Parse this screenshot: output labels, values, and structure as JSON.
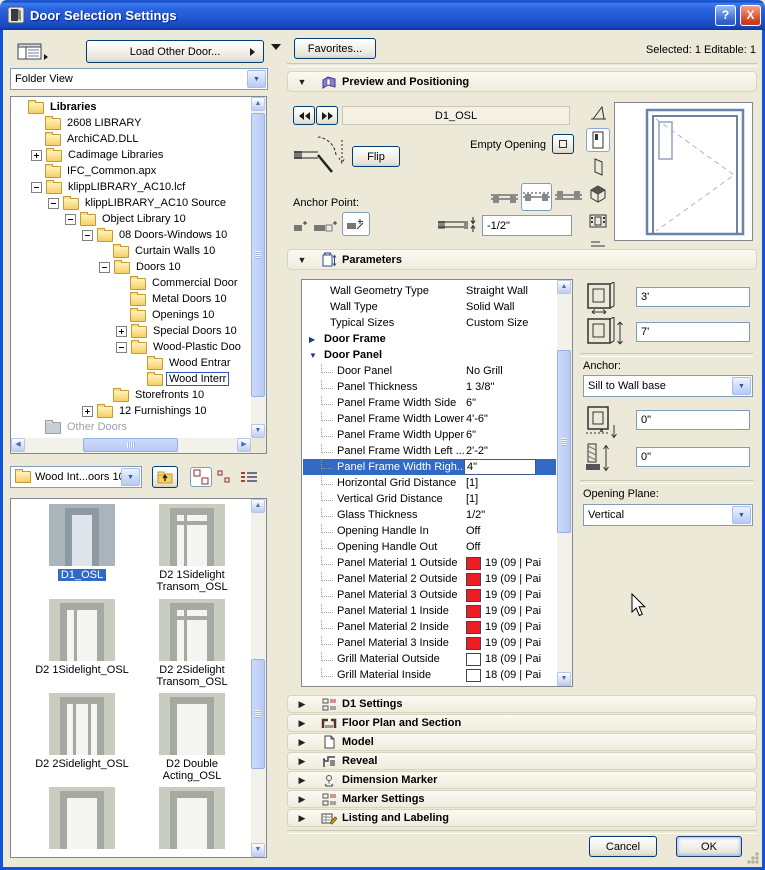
{
  "colors": {
    "selection": "#316ac5",
    "titlebar": "#1f55d2",
    "swatch_red": "#ee1c25",
    "swatch_white": "#ffffff"
  },
  "titlebar": {
    "title": "Door Selection Settings",
    "help": "?",
    "close": "X"
  },
  "left": {
    "load_button": "Load Other Door...",
    "view_select": "Folder View",
    "tree": [
      {
        "label": "Libraries"
      },
      {
        "label": "2608 LIBRARY"
      },
      {
        "label": "ArchiCAD.DLL"
      },
      {
        "label": "Cadimage Libraries"
      },
      {
        "label": "IFC_Common.apx"
      },
      {
        "label": "klippLIBRARY_AC10.lcf"
      },
      {
        "label": "klippLIBRARY_AC10 Source"
      },
      {
        "label": "Object Library 10"
      },
      {
        "label": "08 Doors-Windows 10"
      },
      {
        "label": "Curtain Walls 10"
      },
      {
        "label": "Doors 10"
      },
      {
        "label": "Commercial Door"
      },
      {
        "label": "Metal Doors 10"
      },
      {
        "label": "Openings 10"
      },
      {
        "label": "Special Doors 10"
      },
      {
        "label": "Wood-Plastic Doo"
      },
      {
        "label": "Wood Entrar"
      },
      {
        "label": "Wood Interr",
        "selected": true
      },
      {
        "label": "Storefronts 10"
      },
      {
        "label": "12 Furnishings 10"
      },
      {
        "label": "Other Doors",
        "disabled": true
      }
    ],
    "folder_select": "Wood Int...oors 10",
    "thumbnails": [
      {
        "label": "D1_OSL",
        "selected": true
      },
      {
        "label": "D2 1Sidelight Transom_OSL"
      },
      {
        "label": "D2 1Sidelight_OSL"
      },
      {
        "label": "D2 2Sidelight Transom_OSL"
      },
      {
        "label": "D2 2Sidelight_OSL"
      },
      {
        "label": "D2 Double Acting_OSL"
      },
      {
        "label": ""
      },
      {
        "label": ""
      }
    ]
  },
  "right": {
    "favorites_button": "Favorites...",
    "status": "Selected: 1 Editable: 1",
    "preview": {
      "title": "Preview and Positioning",
      "object_name": "D1_OSL",
      "flip_button": "Flip",
      "empty_opening_label": "Empty Opening",
      "anchor_point_label": "Anchor Point:",
      "reveal_value": "-1/2\""
    },
    "parameters": {
      "title": "Parameters",
      "rows": [
        {
          "label": "Wall Geometry Type",
          "value": "Straight Wall"
        },
        {
          "label": "Wall Type",
          "value": "Solid Wall"
        },
        {
          "label": "Typical Sizes",
          "value": "Custom Size"
        },
        {
          "label": "Door Frame",
          "value": ""
        },
        {
          "label": "Door Panel",
          "value": ""
        },
        {
          "label": "Door Panel",
          "value": "No Grill"
        },
        {
          "label": "Panel Thickness",
          "value": "1 3/8\""
        },
        {
          "label": "Panel Frame Width Side",
          "value": "6\""
        },
        {
          "label": "Panel Frame Width Lower",
          "value": "4'-6\""
        },
        {
          "label": "Panel Frame Width Upper",
          "value": "6\""
        },
        {
          "label": "Panel Frame Width Left ...",
          "value": "2'-2\""
        },
        {
          "label": "Panel Frame Width Righ...",
          "value": "4\"",
          "selected": true
        },
        {
          "label": "Horizontal Grid Distance",
          "value": "[1]"
        },
        {
          "label": "Vertical Grid Distance",
          "value": "[1]"
        },
        {
          "label": "Glass Thickness",
          "value": "1/2\""
        },
        {
          "label": "Opening Handle In",
          "value": "Off"
        },
        {
          "label": "Opening Handle Out",
          "value": "Off"
        },
        {
          "label": "Panel Material 1 Outside",
          "value": "19 (09 | Pai",
          "swatch": "#ee1c25"
        },
        {
          "label": "Panel Material 2 Outside",
          "value": "19 (09 | Pai",
          "swatch": "#ee1c25"
        },
        {
          "label": "Panel Material 3 Outside",
          "value": "19 (09 | Pai",
          "swatch": "#ee1c25"
        },
        {
          "label": "Panel Material 1 Inside",
          "value": "19 (09 | Pai",
          "swatch": "#ee1c25"
        },
        {
          "label": "Panel Material 2 Inside",
          "value": "19 (09 | Pai",
          "swatch": "#ee1c25"
        },
        {
          "label": "Panel Material 3 Inside",
          "value": "19 (09 | Pai",
          "swatch": "#ee1c25"
        },
        {
          "label": "Grill Material Outside",
          "value": "18 (09 | Pai",
          "swatch": "#ffffff"
        },
        {
          "label": "Grill Material Inside",
          "value": "18 (09 | Pai",
          "swatch": "#ffffff"
        }
      ],
      "width_value": "3'",
      "height_value": "7'",
      "anchor_label": "Anchor:",
      "anchor_value": "Sill to Wall base",
      "sill_offset_value": "0\"",
      "head_offset_value": "0\"",
      "opening_plane_label": "Opening Plane:",
      "opening_plane_value": "Vertical"
    },
    "panels": [
      {
        "label": "D1 Settings"
      },
      {
        "label": "Floor Plan and Section"
      },
      {
        "label": "Model"
      },
      {
        "label": "Reveal"
      },
      {
        "label": "Dimension Marker"
      },
      {
        "label": "Marker Settings"
      },
      {
        "label": "Listing and Labeling"
      }
    ],
    "cancel_button": "Cancel",
    "ok_button": "OK"
  }
}
